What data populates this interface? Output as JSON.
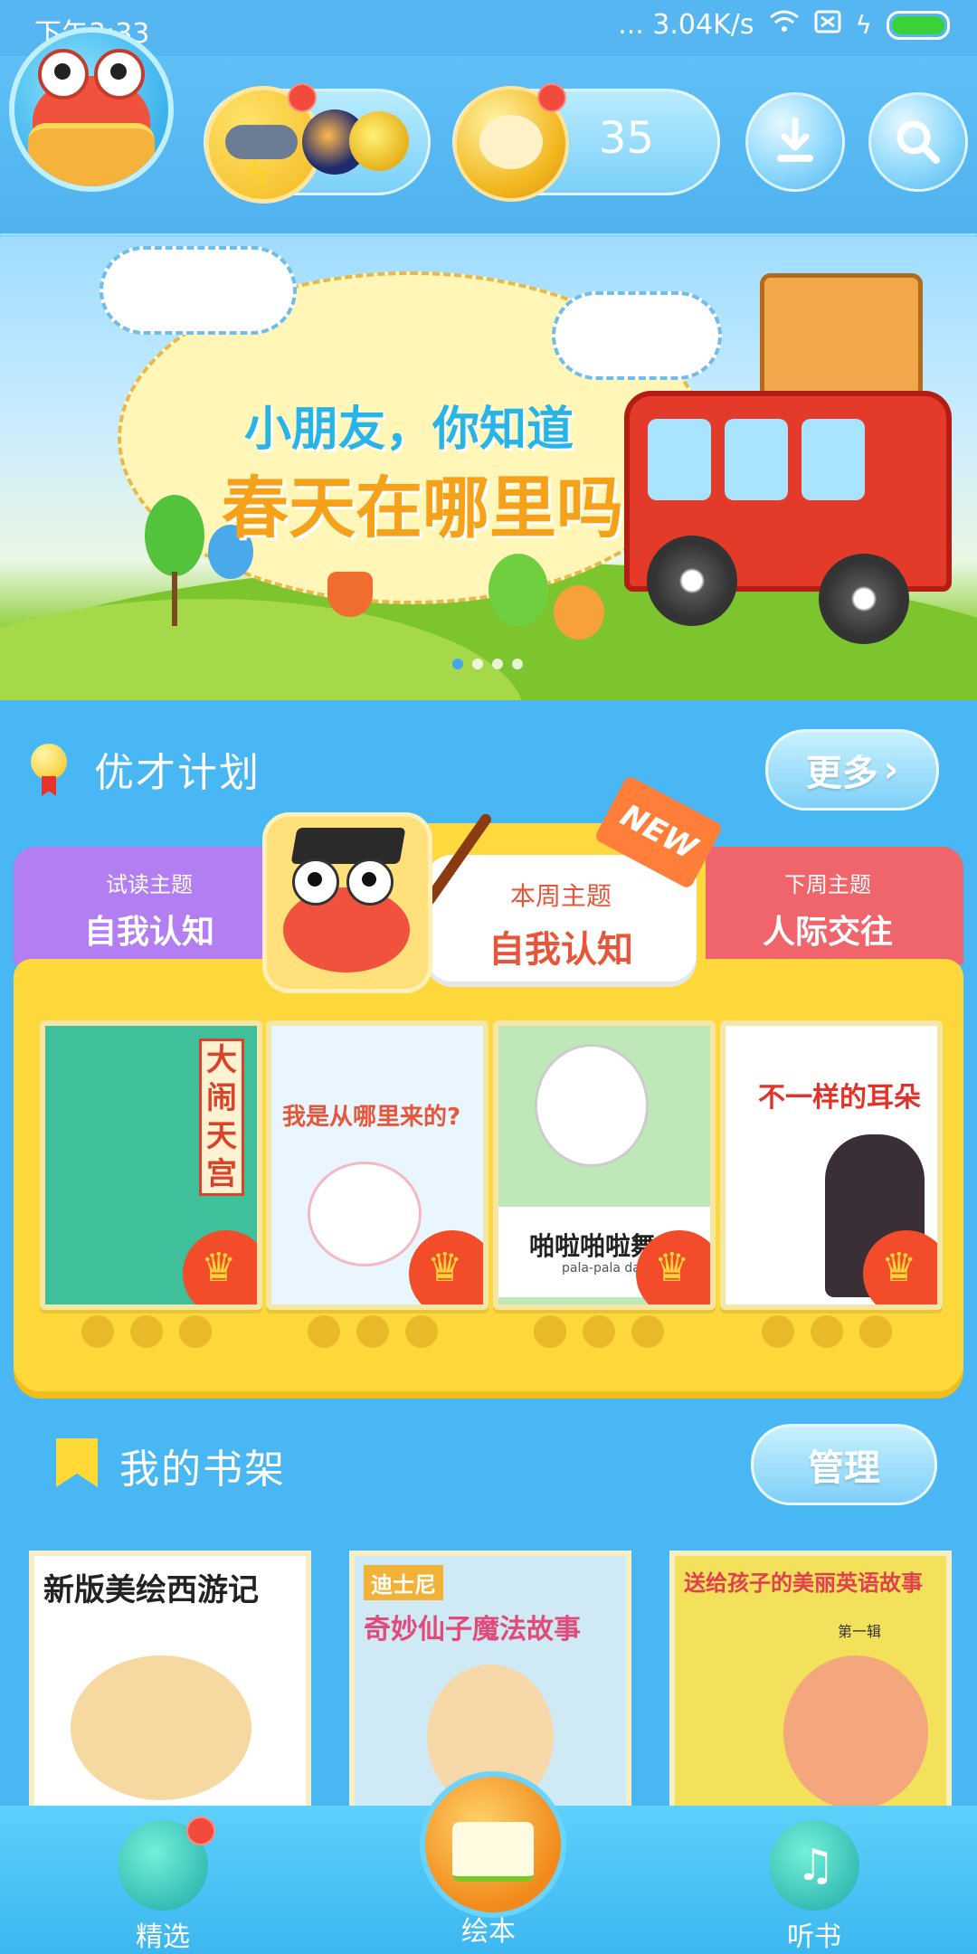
{
  "status_bar": {
    "time": "下午3:33",
    "network_speed": "... 3.04K/s"
  },
  "header": {
    "coin_count": "35",
    "icons": [
      "crab-avatar-icon",
      "weather-icon",
      "coin-icon",
      "download-icon",
      "search-icon"
    ]
  },
  "banner": {
    "line1": "小朋友，你知道",
    "line2": "春天在哪里吗?",
    "page_indicator": {
      "count": 4,
      "active": 0
    }
  },
  "plan": {
    "title": "优才计划",
    "more_label": "更多",
    "trial": {
      "label": "试读主题",
      "topic": "自我认知"
    },
    "this_week": {
      "label": "本周主题",
      "topic": "自我认知",
      "badge": "NEW"
    },
    "next_week": {
      "label": "下周主题",
      "topic": "人际交往"
    },
    "books": [
      {
        "title": "大闹天宫",
        "color": "#3fbf9a"
      },
      {
        "title": "我是从哪里来的?",
        "color": "#eaf6ff"
      },
      {
        "title": "啪啦啪啦舞",
        "subtitle": "pala-pala dance",
        "color": "#bfe8b8"
      },
      {
        "title": "不一样的耳朵",
        "color": "#ffffff"
      }
    ]
  },
  "shelf": {
    "title": "我的书架",
    "manage_label": "管理",
    "books": [
      {
        "title": "新版美绘西游记",
        "color": "#ffffff"
      },
      {
        "title": "奇妙仙子魔法故事",
        "brand": "迪士尼",
        "color": "#cfe9f5"
      },
      {
        "title": "送给孩子的美丽英语故事",
        "subtitle": "第一辑",
        "color": "#f3e05b"
      }
    ]
  },
  "bottom_nav": {
    "items": [
      {
        "label": "精选",
        "icon": "featured-icon"
      },
      {
        "label": "绘本",
        "icon": "picture-book-icon"
      },
      {
        "label": "听书",
        "icon": "headphones-icon"
      }
    ]
  },
  "colors": {
    "background": "#49b7f3",
    "plan_yellow": "#ffd83b",
    "trial_purple": "#b27ef2",
    "next_red": "#f0646c",
    "accent_orange": "#e8563a"
  }
}
